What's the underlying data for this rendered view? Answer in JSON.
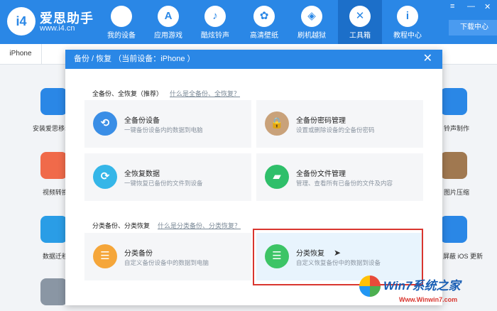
{
  "app": {
    "name": "爱思助手",
    "url": "www.i4.cn",
    "logo_text": "i4"
  },
  "nav": [
    {
      "label": "我的设备",
      "icon": "apple-icon",
      "glyph": ""
    },
    {
      "label": "应用游戏",
      "icon": "app-store-icon",
      "glyph": "A"
    },
    {
      "label": "酷炫铃声",
      "icon": "bell-icon",
      "glyph": "♪"
    },
    {
      "label": "高清壁纸",
      "icon": "flower-icon",
      "glyph": "✿"
    },
    {
      "label": "刷机越狱",
      "icon": "box-icon",
      "glyph": "◈"
    },
    {
      "label": "工具箱",
      "icon": "tools-icon",
      "glyph": "✕"
    },
    {
      "label": "教程中心",
      "icon": "info-icon",
      "glyph": "i"
    }
  ],
  "download_center": "下载中心",
  "window_controls": {
    "menu": "≡",
    "minimize": "—",
    "close": "✕"
  },
  "tab": {
    "label": "iPhone"
  },
  "background_tools": [
    {
      "label": "安装爱思移动端",
      "color": "#2a87e6"
    },
    {
      "label": "视频转换",
      "color": "#f06a4a"
    },
    {
      "label": "数据迁移",
      "color": "#2a9de6"
    },
    {
      "label": "铃声制作",
      "color": "#2a87e6"
    },
    {
      "label": "图片压缩",
      "color": "#a07850"
    },
    {
      "label": "屏蔽 iOS 更新",
      "color": "#2a87e6"
    }
  ],
  "dialog": {
    "title": "备份 / 恢复 （当前设备：iPhone ）",
    "close": "✕",
    "section1": {
      "title": "全备份、全恢复（推荐）",
      "link": "什么是全备份、全恢复？"
    },
    "section2": {
      "title": "分类备份、分类恢复",
      "link": "什么是分类备份、分类恢复？"
    },
    "cards": [
      {
        "title": "全备份设备",
        "desc": "一键备份设备内的数据到电脑",
        "icon": "backup-clock-icon",
        "color": "#3a8ee6",
        "glyph": "⟲"
      },
      {
        "title": "全备份密码管理",
        "desc": "设置或删除设备的全备份密码",
        "icon": "lock-icon",
        "color": "#c9a27a",
        "glyph": "🔒"
      },
      {
        "title": "全恢复数据",
        "desc": "一键恢复已备份的文件到设备",
        "icon": "restore-clock-icon",
        "color": "#35b6e8",
        "glyph": "⟳"
      },
      {
        "title": "全备份文件管理",
        "desc": "管理、查看所有已备份的文件及内容",
        "icon": "folder-icon",
        "color": "#2fbf6a",
        "glyph": "▰"
      },
      {
        "title": "分类备份",
        "desc": "自定义备份设备中的数据到电脑",
        "icon": "category-backup-icon",
        "color": "#f5a63a",
        "glyph": "☰"
      },
      {
        "title": "分类恢复",
        "desc": "自定义恢复备份中的数据到设备",
        "icon": "category-restore-icon",
        "color": "#3cc466",
        "glyph": "☰"
      }
    ]
  },
  "watermark": {
    "title": "Win7系统之家",
    "url": "Www.Winwin7.com"
  }
}
